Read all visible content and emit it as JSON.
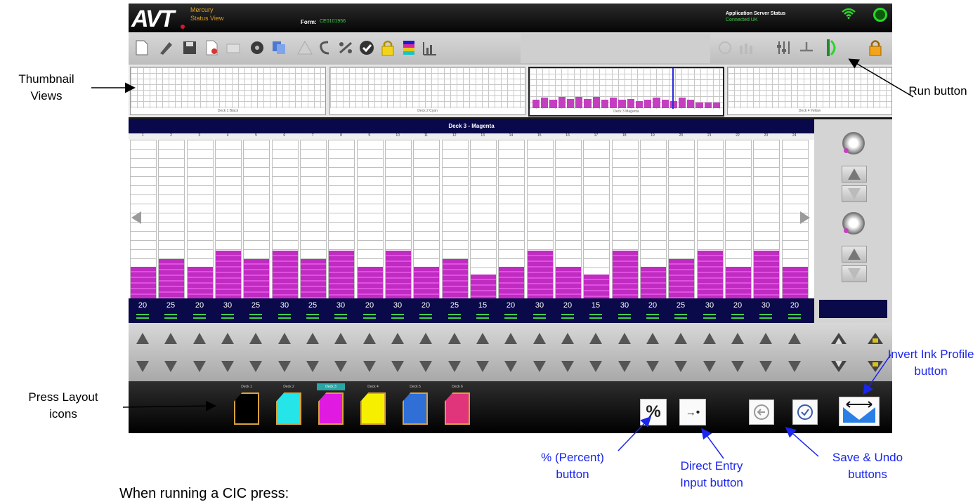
{
  "app": {
    "logo": "AVT",
    "name_line1": "Mercury",
    "name_line2": "Status View",
    "form_label": "Form:",
    "form_value": "CE0101956",
    "server_status_label": "Application Server Status",
    "server_status_value": "Connected UK"
  },
  "thumbnails": [
    {
      "caption": "Deck 1 Black"
    },
    {
      "caption": "Deck 2 Cyan"
    },
    {
      "caption": "Deck 3 Magenta"
    },
    {
      "caption": "Deck 4 Yellow"
    }
  ],
  "deck_title": "Deck 3 - Magenta",
  "zone_numbers": [
    "1",
    "2",
    "3",
    "4",
    "5",
    "6",
    "7",
    "8",
    "9",
    "10",
    "11",
    "12",
    "13",
    "14",
    "15",
    "16",
    "17",
    "18",
    "19",
    "20",
    "21",
    "22",
    "23",
    "24"
  ],
  "zone_values": [
    20,
    25,
    20,
    30,
    25,
    30,
    25,
    30,
    20,
    30,
    20,
    25,
    15,
    20,
    30,
    20,
    15,
    30,
    20,
    25,
    30,
    20,
    30,
    20
  ],
  "decks": [
    {
      "label": "Deck 1",
      "color": "#000000"
    },
    {
      "label": "Deck 2",
      "color": "#25e5e8"
    },
    {
      "label": "Deck 3",
      "color": "#e01ae0",
      "selected": true
    },
    {
      "label": "Deck 4",
      "color": "#f7ef00"
    },
    {
      "label": "Deck 5",
      "color": "#2f6fd6"
    },
    {
      "label": "Deck 6",
      "color": "#e0357a"
    }
  ],
  "buttons": {
    "percent": "%",
    "direct_entry": "→•"
  },
  "annotations": {
    "thumbnail_views": "Thumbnail Views",
    "run_button": "Run button",
    "press_layout_icons": "Press Layout icons",
    "invert_ink_profile": "Invert Ink Profile button",
    "percent_button": "% (Percent) button",
    "direct_entry": "Direct Entry Input button",
    "save_undo": "Save & Undo buttons"
  },
  "footer_text": "When running a CIC press:",
  "colors": {
    "magenta": "#c02bc2",
    "navy": "#08084a",
    "annotation_blue": "#1a25ee"
  }
}
